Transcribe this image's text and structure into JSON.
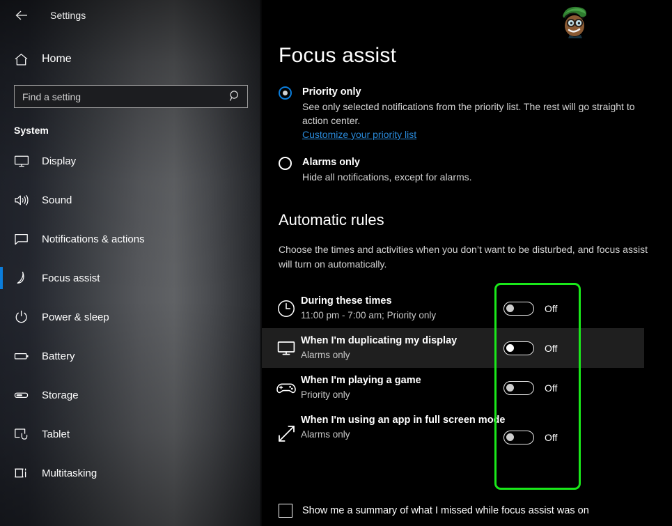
{
  "titlebar": {
    "back_icon": "back-arrow-icon",
    "title": "Settings"
  },
  "sidebar": {
    "home": {
      "label": "Home",
      "icon": "home-icon"
    },
    "search": {
      "placeholder": "Find a setting",
      "value": "",
      "icon": "search-icon"
    },
    "group_title": "System",
    "accent_color": "#0b7ddb",
    "items": [
      {
        "label": "Display",
        "icon": "monitor-icon",
        "selected": false
      },
      {
        "label": "Sound",
        "icon": "speaker-icon",
        "selected": false
      },
      {
        "label": "Notifications & actions",
        "icon": "chat-bubble-icon",
        "selected": false
      },
      {
        "label": "Focus assist",
        "icon": "moon-icon",
        "selected": true
      },
      {
        "label": "Power & sleep",
        "icon": "power-icon",
        "selected": false
      },
      {
        "label": "Battery",
        "icon": "battery-icon",
        "selected": false
      },
      {
        "label": "Storage",
        "icon": "storage-icon",
        "selected": false
      },
      {
        "label": "Tablet",
        "icon": "tablet-icon",
        "selected": false
      },
      {
        "label": "Multitasking",
        "icon": "multitasking-icon",
        "selected": false
      }
    ]
  },
  "main": {
    "page_title": "Focus assist",
    "avatar_icon": "user-avatar-cartoon",
    "modes": [
      {
        "label": "Priority only",
        "selected": true,
        "description": "See only selected notifications from the priority list. The rest will go straight to action center.",
        "link": "Customize your priority list",
        "link_color": "#2a8ada"
      },
      {
        "label": "Alarms only",
        "selected": false,
        "description": "Hide all notifications, except for alarms.",
        "link": "",
        "link_color": ""
      }
    ],
    "automatic_rules": {
      "title": "Automatic rules",
      "description": "Choose the times and activities when you don’t want to be disturbed, and focus assist will turn on automatically.",
      "rules": [
        {
          "name": "During these times",
          "sub": "11:00 pm - 7:00 am; Priority only",
          "icon": "clock-icon",
          "toggle_state": "Off",
          "hovered": false
        },
        {
          "name": "When I'm duplicating my display",
          "sub": "Alarms only",
          "icon": "monitor-icon",
          "toggle_state": "Off",
          "hovered": true
        },
        {
          "name": "When I'm playing a game",
          "sub": "Priority only",
          "icon": "gamepad-icon",
          "toggle_state": "Off",
          "hovered": false
        },
        {
          "name": "When I'm using an app in full screen mode",
          "sub": "Alarms only",
          "icon": "fullscreen-arrows-icon",
          "toggle_state": "Off",
          "hovered": false
        }
      ]
    },
    "summary_checkbox": {
      "label": "Show me a summary of what I missed while focus assist was on",
      "checked": false
    },
    "annotation": {
      "color": "#1ae81a",
      "shape": "rounded-rectangle-highlight"
    }
  }
}
